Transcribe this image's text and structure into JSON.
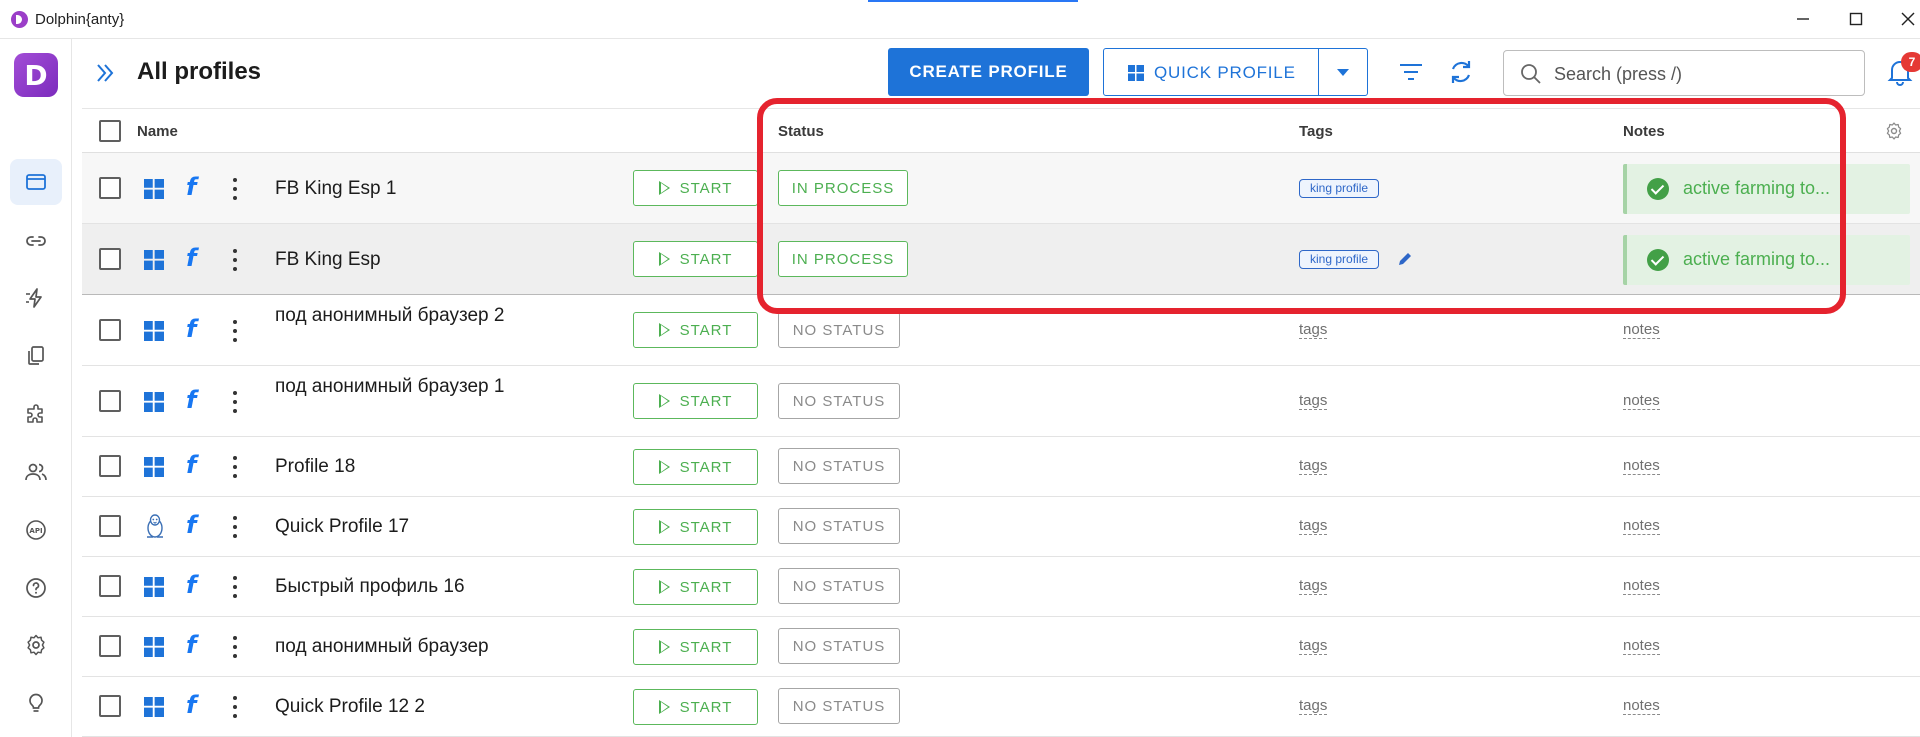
{
  "window": {
    "title": "Dolphin{anty}",
    "minimize": "—",
    "maximize": "☐",
    "close": "✕"
  },
  "brand": {
    "letter": "D",
    "color": "#8e3cc9"
  },
  "header": {
    "title": "All profiles",
    "create_label": "CREATE PROFILE",
    "quick_label": "QUICK PROFILE",
    "search_placeholder": "Search (press /)",
    "notification_count": "7"
  },
  "columns": {
    "name": "Name",
    "status": "Status",
    "tags": "Tags",
    "notes": "Notes"
  },
  "start_label": "START",
  "profiles": [
    {
      "name": "FB King Esp 1",
      "os": "windows",
      "status": "IN PROCESS",
      "tag": "king profile",
      "note": "active farming to..."
    },
    {
      "name": "FB King Esp",
      "os": "windows",
      "status": "IN PROCESS",
      "tag": "king profile",
      "note": "active farming to..."
    },
    {
      "name": "под анонимный браузер 2",
      "os": "windows",
      "status": "NO STATUS",
      "tag": "tags",
      "note": "notes"
    },
    {
      "name": "под анонимный браузер 1",
      "os": "windows",
      "status": "NO STATUS",
      "tag": "tags",
      "note": "notes"
    },
    {
      "name": "Profile 18",
      "os": "windows",
      "status": "NO STATUS",
      "tag": "tags",
      "note": "notes"
    },
    {
      "name": "Quick Profile 17",
      "os": "linux",
      "status": "NO STATUS",
      "tag": "tags",
      "note": "notes"
    },
    {
      "name": "Быстрый профиль 16",
      "os": "windows",
      "status": "NO STATUS",
      "tag": "tags",
      "note": "notes"
    },
    {
      "name": "под анонимный браузер",
      "os": "windows",
      "status": "NO STATUS",
      "tag": "tags",
      "note": "notes"
    },
    {
      "name": "Quick Profile 12 2",
      "os": "windows",
      "status": "NO STATUS",
      "tag": "tags",
      "note": "notes"
    }
  ],
  "sidebar_icons": [
    "profiles-icon",
    "proxy-link-icon",
    "automation-icon",
    "clipboard-icon",
    "extensions-icon",
    "users-icon",
    "api-icon",
    "help-icon",
    "settings-icon",
    "idea-bulb-icon"
  ],
  "colors": {
    "accent": "#1e73d8",
    "success": "#4caf50",
    "highlight": "#e5232e"
  }
}
